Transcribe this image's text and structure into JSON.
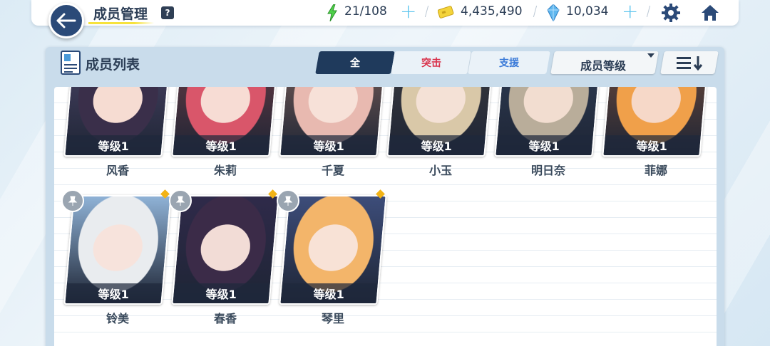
{
  "header": {
    "title": "成员管理",
    "help_label": "?",
    "stamina": "21/108",
    "credits": "4,435,490",
    "gems": "10,034"
  },
  "panel": {
    "title": "成员列表",
    "tabs": [
      {
        "label": "全",
        "active": true
      },
      {
        "label": "突击",
        "active": false
      },
      {
        "label": "支援",
        "active": false
      }
    ],
    "sort_label": "成员等级"
  },
  "members": [
    {
      "name": "风香",
      "level": "等级1",
      "hair": "#3a2f4a",
      "skin": "#f6dcd2",
      "bg": "#4b4466"
    },
    {
      "name": "朱莉",
      "level": "等级1",
      "hair": "#d9566a",
      "skin": "#f7dcd4",
      "bg": "#6a3b44"
    },
    {
      "name": "千夏",
      "level": "等级1",
      "hair": "#e8b9b0",
      "skin": "#f7e1d8",
      "bg": "#7b5f58"
    },
    {
      "name": "小玉",
      "level": "等级1",
      "hair": "#d9c8a8",
      "skin": "#f4e1d6",
      "bg": "#3b3a3e"
    },
    {
      "name": "明日奈",
      "level": "等级1",
      "hair": "#b9ad9a",
      "skin": "#f2ddd0",
      "bg": "#2f3d55"
    },
    {
      "name": "菲娜",
      "level": "等级1",
      "hair": "#f0a04a",
      "skin": "#f6d8c8",
      "bg": "#6f4a3a"
    },
    {
      "name": "铃美",
      "level": "等级1",
      "hair": "#e9ecef",
      "skin": "#f7e3dc",
      "bg": "#8fb2d6"
    },
    {
      "name": "春香",
      "level": "等级1",
      "hair": "#3b2b48",
      "skin": "#f2dcd6",
      "bg": "#2f2a4a"
    },
    {
      "name": "琴里",
      "level": "等级1",
      "hair": "#f3b56a",
      "skin": "#f8e2d6",
      "bg": "#3d4d7a"
    }
  ]
}
